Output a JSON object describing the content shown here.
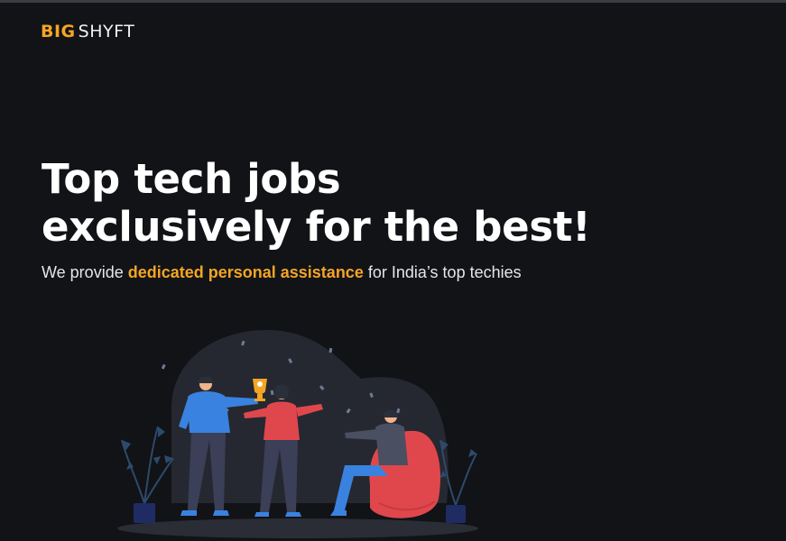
{
  "header": {
    "logo_part1": "BIG",
    "logo_part2": "SHYFT"
  },
  "hero": {
    "headline_line1": "Top tech jobs",
    "headline_line2": "exclusively for the best!",
    "subtitle_prefix": "We provide ",
    "subtitle_highlight": "dedicated personal assistance",
    "subtitle_suffix": " for India’s top techies"
  },
  "colors": {
    "background": "#111317",
    "accent": "#f5a524",
    "heading": "#ffffff",
    "text": "#e6e6e6"
  },
  "illustration": {
    "icon": "team-celebration-illustration"
  }
}
